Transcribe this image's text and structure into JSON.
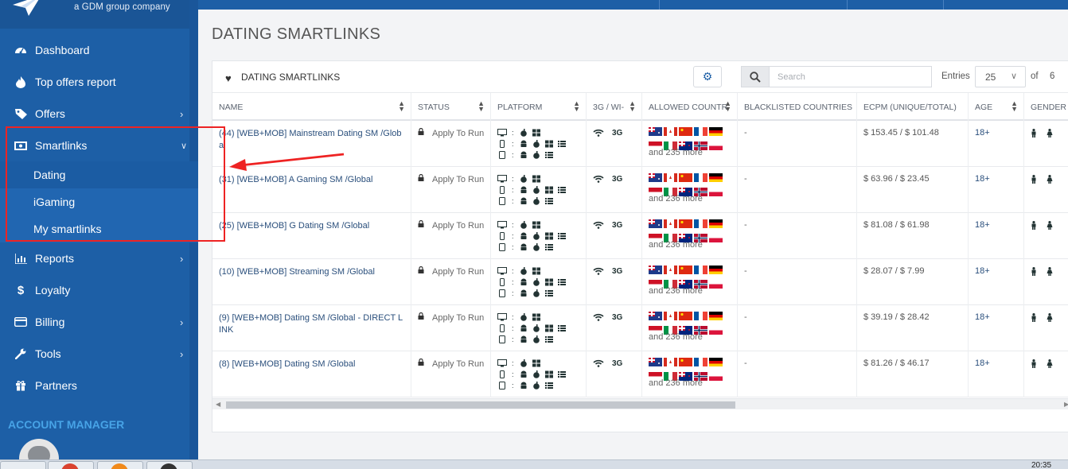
{
  "brand": {
    "tagline": "a GDM group company",
    "logo_icon": "paper-plane-logo"
  },
  "sidebar": {
    "items": [
      {
        "label": "Dashboard",
        "icon": "dashboard-icon"
      },
      {
        "label": "Top offers report",
        "icon": "fire-icon"
      },
      {
        "label": "Offers",
        "icon": "tag-icon"
      },
      {
        "label": "Smartlinks",
        "icon": "money-bill-icon"
      },
      {
        "label": "Reports",
        "icon": "bar-chart-icon"
      },
      {
        "label": "Loyalty",
        "icon": "dollar-icon"
      },
      {
        "label": "Billing",
        "icon": "credit-card-icon"
      },
      {
        "label": "Tools",
        "icon": "wrench-icon"
      },
      {
        "label": "Partners",
        "icon": "gift-icon"
      }
    ],
    "smartlinks_sub": [
      {
        "label": "Dating",
        "active": true
      },
      {
        "label": "iGaming"
      },
      {
        "label": "My smartlinks"
      }
    ],
    "account_manager_label": "ACCOUNT MANAGER"
  },
  "page": {
    "title": "DATING SMARTLINKS"
  },
  "card": {
    "title": "DATING SMARTLINKS",
    "search_placeholder": "Search",
    "entries_label": "Entries",
    "entries_value": "25",
    "of_label": "of",
    "of_value": "6"
  },
  "table": {
    "columns": [
      "NAME",
      "STATUS",
      "PLATFORM",
      "3G / WI-",
      "ALLOWED COUNTR",
      "BLACKLISTED COUNTRIES",
      "ECPM (UNIQUE/TOTAL)",
      "AGE",
      "GENDER"
    ],
    "rows": [
      {
        "name": "(44) [WEB+MOB] Mainstream Dating SM /Global",
        "status": "Apply To Run",
        "connection": "3G",
        "countries_more": "and 235 more",
        "blacklisted": "-",
        "ecpm": "$ 153.45 / $ 101.48",
        "age": "18+"
      },
      {
        "name": "(31) [WEB+MOB] A Gaming SM /Global",
        "status": "Apply To Run",
        "connection": "3G",
        "countries_more": "and 236 more",
        "blacklisted": "-",
        "ecpm": "$ 63.96 / $ 23.45",
        "age": "18+"
      },
      {
        "name": "(25) [WEB+MOB] G Dating SM /Global",
        "status": "Apply To Run",
        "connection": "3G",
        "countries_more": "and 236 more",
        "blacklisted": "-",
        "ecpm": "$ 81.08 / $ 61.98",
        "age": "18+"
      },
      {
        "name": "(10) [WEB+MOB] Streaming SM /Global",
        "status": "Apply To Run",
        "connection": "3G",
        "countries_more": "and 236 more",
        "blacklisted": "-",
        "ecpm": "$ 28.07 / $ 7.99",
        "age": "18+"
      },
      {
        "name": "(9) [WEB+MOB] Dating SM /Global - DIRECT LINK",
        "status": "Apply To Run",
        "connection": "3G",
        "countries_more": "and 236 more",
        "blacklisted": "-",
        "ecpm": "$ 39.19 / $ 28.42",
        "age": "18+"
      },
      {
        "name": "(8) [WEB+MOB] Dating SM /Global",
        "status": "Apply To Run",
        "connection": "3G",
        "countries_more": "and 236 more",
        "blacklisted": "-",
        "ecpm": "$ 81.26 / $ 46.17",
        "age": "18+"
      }
    ]
  },
  "taskbar": {
    "clock": "20:35"
  },
  "colors": {
    "sidebar": "#1d5fa6",
    "accent": "#47a3e6",
    "highlight": "#ee2323"
  }
}
